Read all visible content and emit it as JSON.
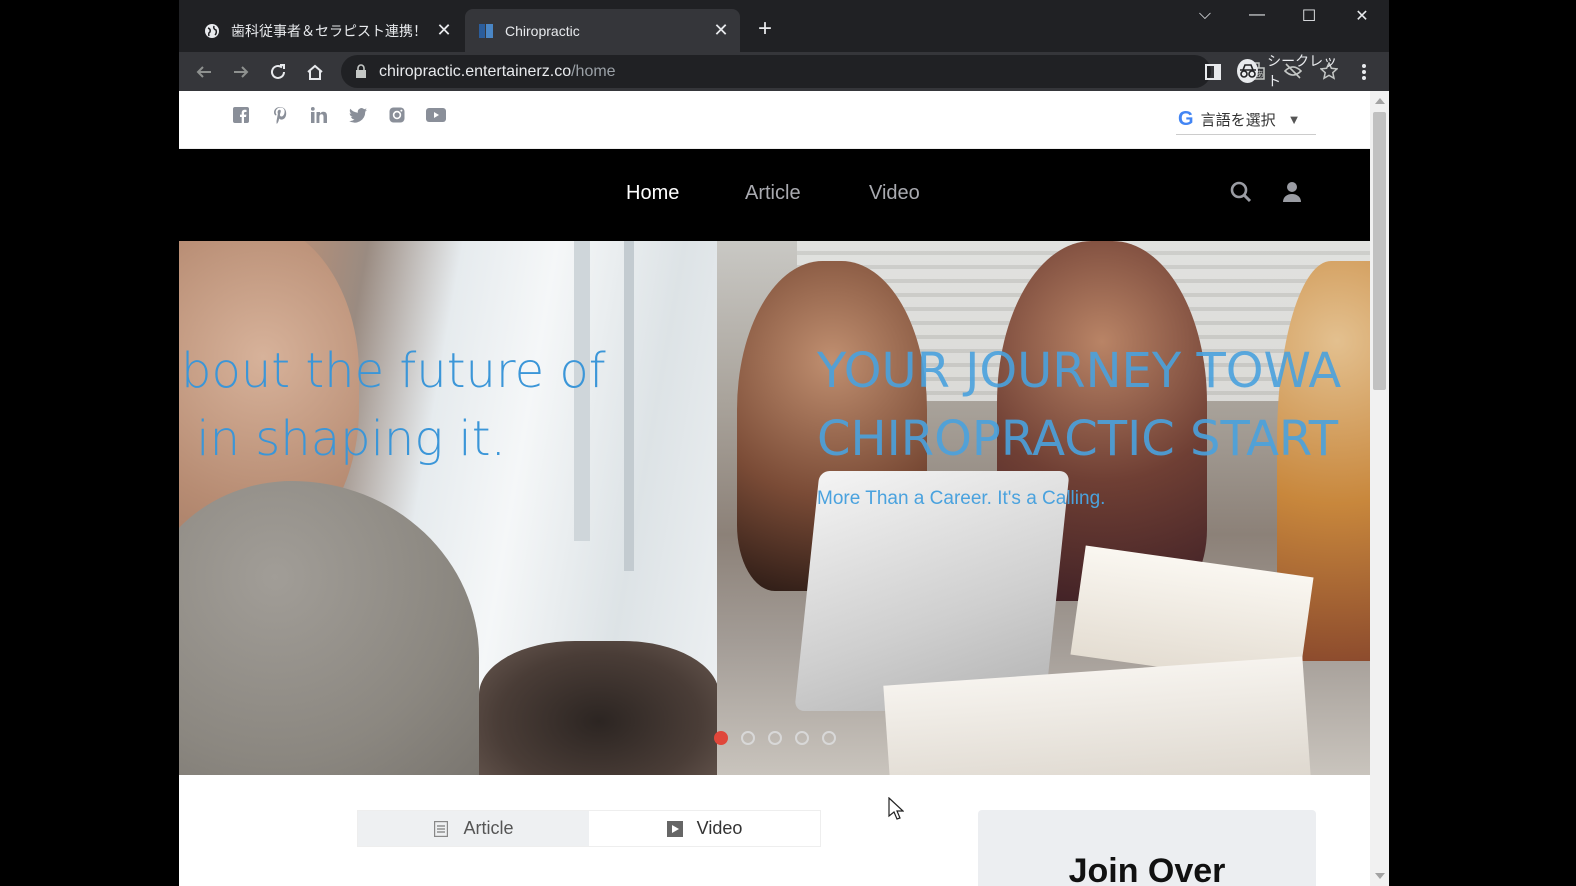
{
  "browser": {
    "tabs": [
      {
        "title": "歯科従事者＆セラピスト連携！【整",
        "active": false
      },
      {
        "title": "Chiropractic",
        "active": true
      }
    ],
    "new_tab_label": "+",
    "url_host": "chiropractic.entertainerz.co",
    "url_path": "/home",
    "profile_label": "シークレット"
  },
  "site": {
    "social_icons": [
      "facebook-icon",
      "pinterest-icon",
      "linkedin-icon",
      "twitter-icon",
      "instagram-icon",
      "youtube-icon"
    ],
    "language_selector": {
      "g": "G",
      "label": "言語を選択",
      "arrow": "▼"
    },
    "nav": {
      "home": "Home",
      "article": "Article",
      "video": "Video"
    },
    "hero": {
      "left_headline": "bout the future of\n in shaping it.",
      "right_headline": "YOUR JOURNEY TOWA\nCHIROPRACTIC START",
      "right_sub": "More Than a Career. It's a Calling.",
      "dots_count": 5,
      "active_dot": 0
    },
    "content_tabs": {
      "article": "Article",
      "video": "Video"
    },
    "join_card_title": "Join Over"
  },
  "colors": {
    "accent_blue": "#3b96d8",
    "dot_active": "#e0463a",
    "nav_bg": "#000000"
  }
}
